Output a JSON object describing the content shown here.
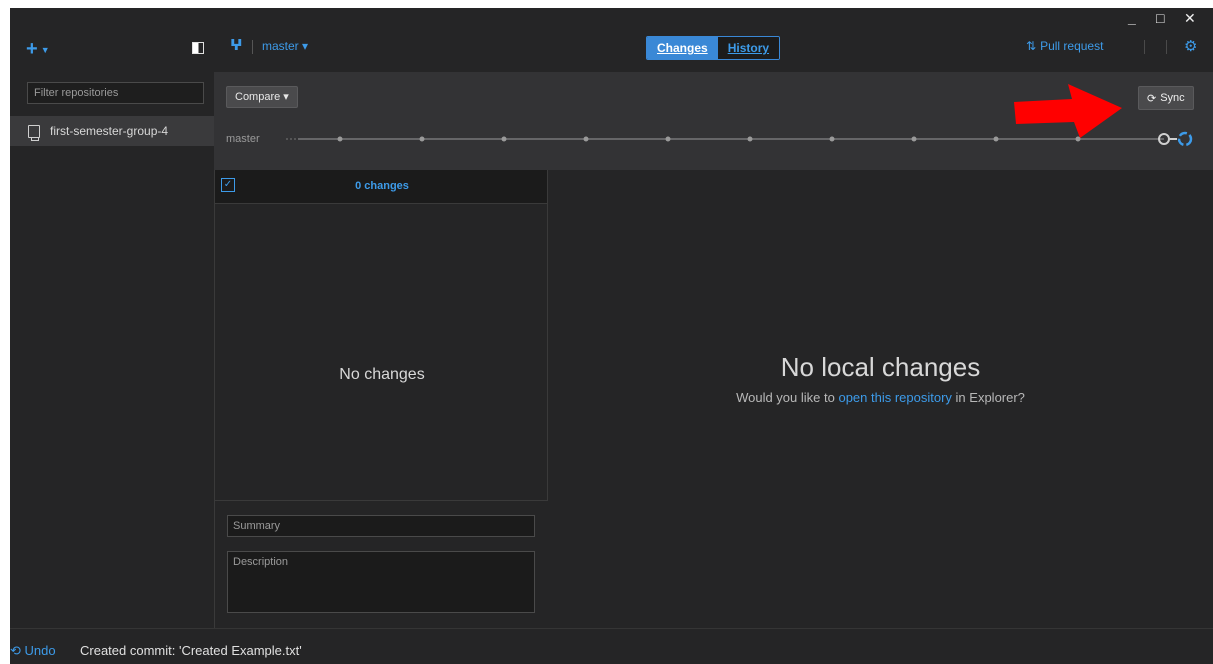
{
  "sidebar": {
    "filter_placeholder": "Filter repositories",
    "repositories": [
      {
        "name": "first-semester-group-4"
      }
    ]
  },
  "header": {
    "branch": "master ▾",
    "tabs": [
      {
        "label": "Changes",
        "active": true
      },
      {
        "label": "History",
        "active": false
      }
    ],
    "pull_request": "Pull request",
    "window_controls": [
      "_",
      "□",
      "✕"
    ]
  },
  "compare_bar": {
    "compare_label": "Compare ▾",
    "sync_label": "Sync",
    "timeline_branch": "master"
  },
  "changes": {
    "count_label": "0 changes",
    "empty_label": "No changes",
    "summary_placeholder": "Summary",
    "description_placeholder": "Description"
  },
  "detail": {
    "title": "No local changes",
    "subtitle_pre": "Would you like to",
    "subtitle_link": "open this repository",
    "subtitle_post": "in Explorer?"
  },
  "statusbar": {
    "undo_label": "Undo",
    "message": "Created commit: 'Created Example.txt'"
  },
  "colors": {
    "accent": "#3d9be9",
    "background": "#252526",
    "arrow": "#ff0000"
  }
}
